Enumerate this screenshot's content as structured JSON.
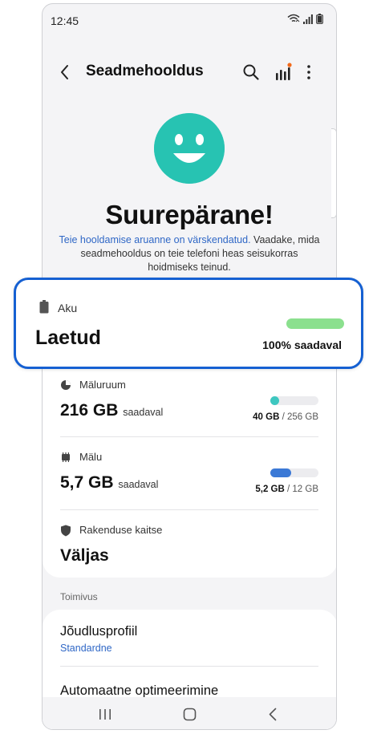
{
  "status": {
    "time": "12:45"
  },
  "appbar": {
    "title": "Seadmehooldus"
  },
  "summary": {
    "headline": "Suurepärane!",
    "link_text": "Teie hooldamise aruanne on värskendatud.",
    "body_text": " Vaadake, mida seadmehooldus on teie telefoni heas seisukorras hoidmiseks teinud."
  },
  "battery": {
    "label": "Aku",
    "value": "Laetud",
    "available": "100% saadaval",
    "level_pct": 100,
    "bar_color": "#8be08e"
  },
  "storage": {
    "label": "Mäluruum",
    "value": "216 GB",
    "unit": "saadaval",
    "used": "40 GB",
    "total": "/ 256 GB",
    "used_pct": 16,
    "bar_color": "#3ec7c0"
  },
  "memory": {
    "label": "Mälu",
    "value": "5,7 GB",
    "unit": "saadaval",
    "used": "5,2 GB",
    "total": "/ 12 GB",
    "used_pct": 43,
    "bar_color": "#3b79d6"
  },
  "app_protection": {
    "label": "Rakenduse kaitse",
    "value": "Väljas"
  },
  "performance": {
    "section_label": "Toimivus",
    "profile_title": "Jõudlusprofiil",
    "profile_value": "Standardne",
    "auto_opt_title": "Automaatne optimeerimine"
  },
  "colors": {
    "accent": "#1560d2",
    "smiley": "#27c3b2",
    "link": "#2f67c6"
  },
  "icons": [
    "back-arrow-icon",
    "search-icon",
    "stats-icon",
    "more-icon",
    "battery-icon",
    "storage-pie-icon",
    "memory-chip-icon",
    "shield-icon",
    "recent-apps-icon",
    "home-icon",
    "back-nav-icon",
    "wifi-icon",
    "signal-icon"
  ]
}
